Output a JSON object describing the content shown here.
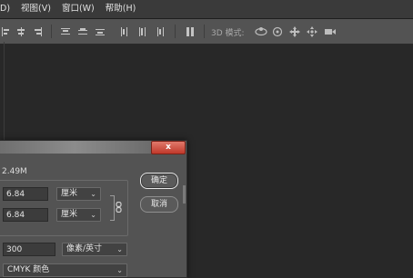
{
  "menubar": {
    "items": [
      "D)",
      "视图(V)",
      "窗口(W)",
      "帮助(H)"
    ]
  },
  "optionsbar": {
    "mode_3d_label": "3D 模式:"
  },
  "dialog": {
    "close_glyph": "x",
    "size_label": "2.49M",
    "width": {
      "value": "6.84",
      "unit": "厘米"
    },
    "height": {
      "value": "6.84",
      "unit": "厘米"
    },
    "resolution": {
      "value": "300",
      "unit": "像素/英寸"
    },
    "mode": {
      "value": "CMYK 颜色"
    },
    "ok_label": "确定",
    "cancel_label": "取消"
  }
}
